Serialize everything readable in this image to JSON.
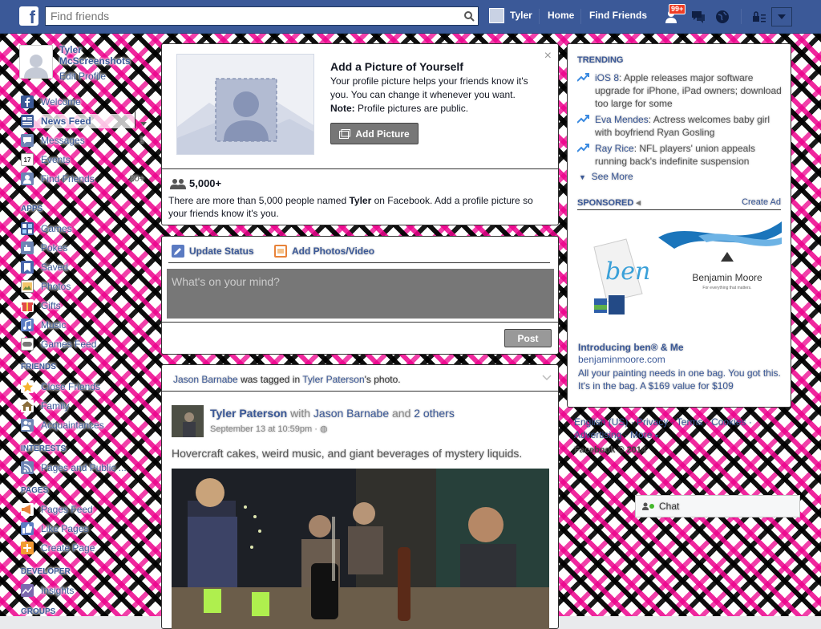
{
  "topbar": {
    "search_placeholder": "Find friends",
    "user_name": "Tyler",
    "home_label": "Home",
    "find_friends_label": "Find Friends",
    "notification_count": "99+"
  },
  "left_nav": {
    "profile_name": "Tyler McScreenshots",
    "edit_profile": "Edit Profile",
    "main_items": [
      {
        "label": "Welcome",
        "icon": "facebook-icon"
      },
      {
        "label": "News Feed",
        "icon": "news-feed-icon"
      },
      {
        "label": "Messages",
        "icon": "messages-icon",
        "count": "1"
      },
      {
        "label": "Events",
        "icon": "calendar-icon",
        "count": ""
      },
      {
        "label": "Find Friends",
        "icon": "find-friends-icon",
        "count": "20+"
      }
    ],
    "apps_header": "APPS",
    "apps": [
      {
        "label": "Games"
      },
      {
        "label": "Pokes"
      },
      {
        "label": "Saved"
      },
      {
        "label": "Photos"
      },
      {
        "label": "Gifts"
      },
      {
        "label": "Music"
      },
      {
        "label": "Games Feed"
      }
    ],
    "friends_header": "FRIENDS",
    "friends": [
      {
        "label": "Close Friends"
      },
      {
        "label": "Family"
      },
      {
        "label": "Acquaintances"
      }
    ],
    "interests_header": "INTERESTS",
    "interests": [
      {
        "label": "Pages and Public ..."
      }
    ],
    "pages_header": "PAGES",
    "pages": [
      {
        "label": "Pages Feed"
      },
      {
        "label": "Like Pages"
      },
      {
        "label": "Create Page"
      }
    ],
    "developer_header": "DEVELOPER",
    "developer": [
      {
        "label": "Insights"
      }
    ],
    "groups_header": "GROUPS"
  },
  "profile_prompt": {
    "title": "Add a Picture of Yourself",
    "desc": "Your profile picture helps your friends know it's you. You can change it whenever you want.",
    "note_label": "Note:",
    "note_text": " Profile pictures are public.",
    "add_button": "Add Picture",
    "close": "×",
    "count": "5,000+",
    "people_pre": "There are more than 5,000 people named ",
    "people_name": "Tyler",
    "people_post": " on Facebook. Add a profile picture so your friends know it's you."
  },
  "composer": {
    "tab_status": "Update Status",
    "tab_photos": "Add Photos/Video",
    "placeholder": "What's on your mind?",
    "post_button": "Post"
  },
  "story": {
    "ctx_actor": "Jason Barnabe",
    "ctx_mid": " was tagged in ",
    "ctx_owner": "Tyler Paterson",
    "ctx_tail": "'s photo.",
    "author": "Tyler Paterson",
    "with": " with ",
    "with_name": "Jason Barnabe",
    "and": " and ",
    "others": "2 others",
    "time": "September 13 at 10:59pm · ",
    "text": "Hovercraft cakes, weird music, and giant beverages of mystery liquids."
  },
  "right": {
    "trending_header": "TRENDING",
    "trends": [
      {
        "topic": "iOS 8",
        "text": ": Apple releases major software upgrade for iPhone, iPad owners; download too large for some"
      },
      {
        "topic": "Eva Mendes",
        "text": ": Actress welcomes baby girl with boyfriend Ryan Gosling"
      },
      {
        "topic": "Ray Rice",
        "text": ": NFL players' union appeals running back's indefinite suspension"
      }
    ],
    "see_more": "See More",
    "sponsored_header": "SPONSORED",
    "create_ad": "Create Ad",
    "ad_brand": "Benjamin Moore",
    "ad_tagline": "For everything that matters.",
    "ad_script": "ben",
    "ad_title": "Introducing ben® & Me",
    "ad_url": "benjaminmoore.com",
    "ad_desc": "All your painting needs in one bag. You got this. It's in the bag. A $169 value for $109",
    "footer_line1": "English (US) · Privacy · Terms · Cookies ·",
    "footer_line2": "Advertising · More",
    "copyright": "Facebook © 2014"
  },
  "chat": {
    "label": "Chat"
  }
}
